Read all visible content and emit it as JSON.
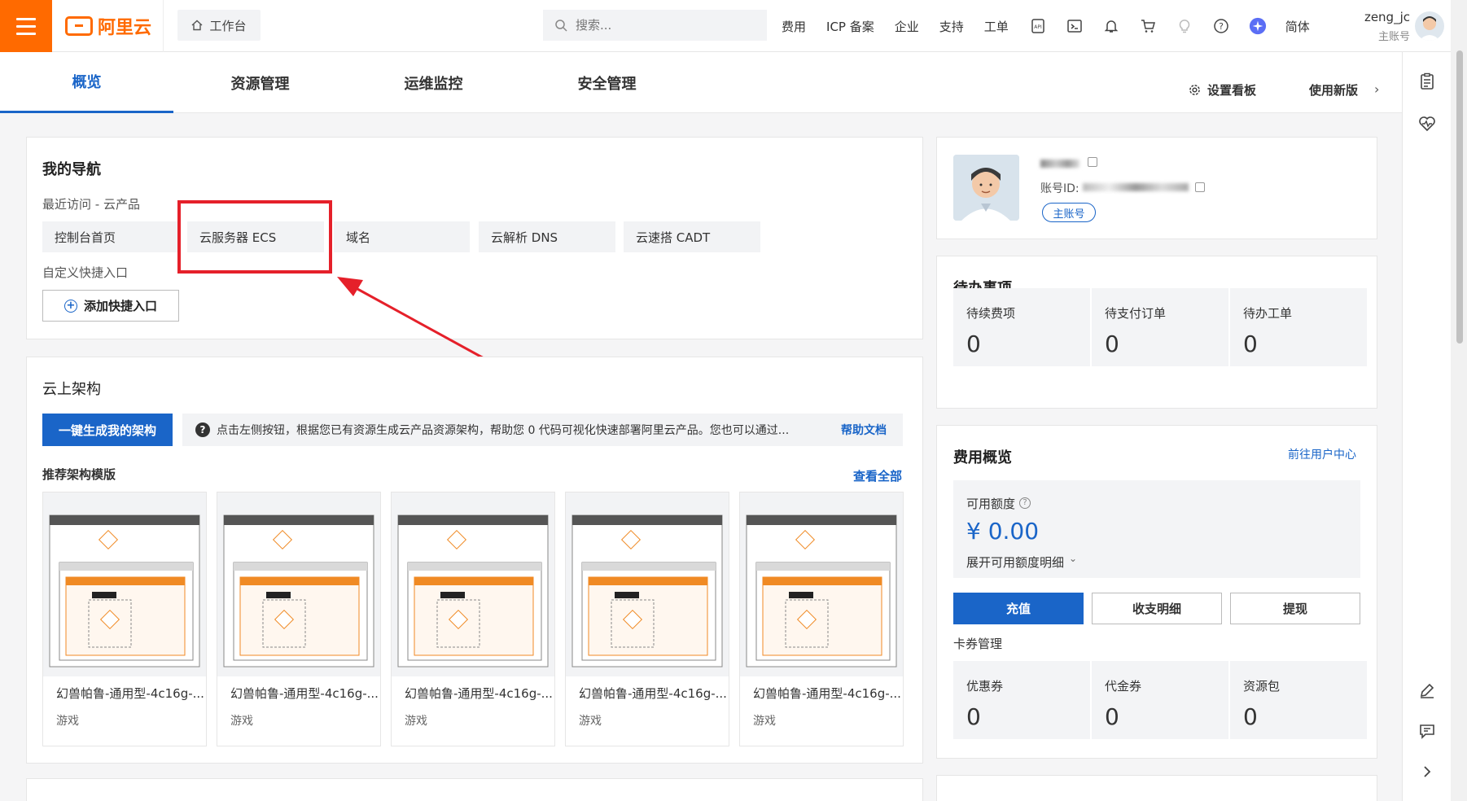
{
  "topbar": {
    "logo_text": "阿里云",
    "workbench": "工作台",
    "search_placeholder": "搜索...",
    "nav": [
      "费用",
      "ICP 备案",
      "企业",
      "支持",
      "工单"
    ],
    "lang": "简体",
    "username": "zeng_jc",
    "account_type": "主账号"
  },
  "tabs": [
    "概览",
    "资源管理",
    "运维监控",
    "安全管理"
  ],
  "tabs_right": {
    "settings": "设置看板",
    "new_version": "使用新版"
  },
  "nav_card": {
    "title": "我的导航",
    "recent_label": "最近访问 - 云产品",
    "recent": [
      "控制台首页",
      "云服务器 ECS",
      "域名",
      "云解析 DNS",
      "云速搭 CADT"
    ],
    "custom_label": "自定义快捷入口",
    "add_button": "添加快捷入口"
  },
  "arch_card": {
    "title": "云上架构",
    "gen_button": "一键生成我的架构",
    "hint": "点击左侧按钮，根据您已有资源生成云产品资源架构，帮助您 0 代码可视化快速部署阿里云产品。您也可以通过...",
    "help_link": "帮助文档",
    "templates_label": "推荐架构模版",
    "view_all": "查看全部",
    "templates": [
      {
        "name": "幻兽帕鲁-通用型-4c16g-...",
        "category": "游戏"
      },
      {
        "name": "幻兽帕鲁-通用型-4c16g-...",
        "category": "游戏"
      },
      {
        "name": "幻兽帕鲁-通用型-4c16g-...",
        "category": "游戏"
      },
      {
        "name": "幻兽帕鲁-通用型-4c16g-...",
        "category": "游戏"
      },
      {
        "name": "幻兽帕鲁-通用型-4c16g-...",
        "category": "游戏"
      }
    ]
  },
  "profile": {
    "account_id_label": "账号ID:",
    "badge": "主账号"
  },
  "todo": {
    "title": "待办事项",
    "items": [
      {
        "label": "待续费项",
        "value": "0"
      },
      {
        "label": "待支付订单",
        "value": "0"
      },
      {
        "label": "待办工单",
        "value": "0"
      }
    ]
  },
  "fee": {
    "title": "费用概览",
    "link": "前往用户中心",
    "available_label": "可用额度",
    "amount": "¥ 0.00",
    "expand": "展开可用额度明细",
    "buttons": [
      "充值",
      "收支明细",
      "提现"
    ],
    "coupon_title": "卡券管理",
    "coupons": [
      {
        "label": "优惠券",
        "value": "0"
      },
      {
        "label": "代金券",
        "value": "0"
      },
      {
        "label": "资源包",
        "value": "0"
      }
    ]
  },
  "colors": {
    "brand": "#ff6a00",
    "primary": "#1a65c8",
    "annotation": "#e5202a"
  }
}
